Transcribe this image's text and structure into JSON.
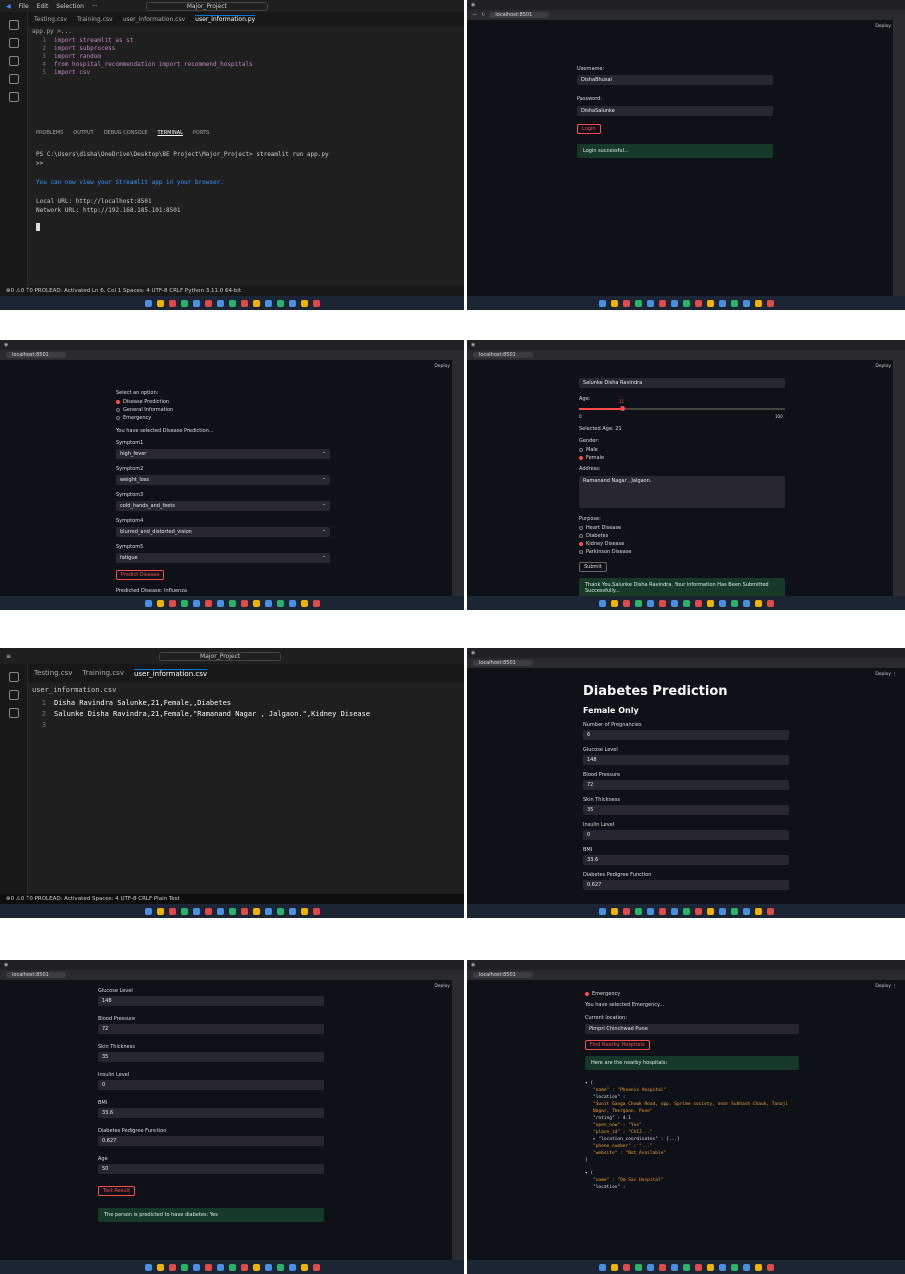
{
  "panel1": {
    "menu": [
      "File",
      "Edit",
      "Selection",
      "···"
    ],
    "search": "Major_Project",
    "tabs": [
      "Testing.csv",
      "Training.csv",
      "user_information.csv",
      "user_information.py"
    ],
    "breadcrumb": "app.py >...",
    "code": [
      [
        "1",
        "import streamlit as st"
      ],
      [
        "2",
        "import subprocess"
      ],
      [
        "3",
        "import random"
      ],
      [
        "4",
        "from hospital_recommendation import recommend_hospitals"
      ],
      [
        "5",
        "import csv"
      ]
    ],
    "term_tabs": [
      "PROBLEMS",
      "OUTPUT",
      "DEBUG CONSOLE",
      "TERMINAL",
      "PORTS"
    ],
    "term_lines": [
      "PS C:\\Users\\disha\\OneDrive\\Desktop\\BE Project\\Major_Project> streamlit run app.py",
      ">>",
      "You can now view your Streamlit app in your browser.",
      "Local URL: http://localhost:8501",
      "Network URL: http://192.168.185.101:8501"
    ],
    "status": "⊗0 ⚠0  ᛘ0  PROLEAD: Activated   Ln 6, Col 1  Spaces: 4  UTF-8  CRLF  Python  3.11.0 64-bit"
  },
  "panel2": {
    "url": "localhost:8501",
    "username_label": "Username:",
    "username": "DishaBhusal",
    "password_label": "Password:",
    "password": "DishaSalunke",
    "login": "Login",
    "msg": "Login successful..."
  },
  "panel3": {
    "url": "localhost:8501",
    "choice_label": "Select an option:",
    "options": [
      "Disease Prediction",
      "General Information",
      "Emergency"
    ],
    "selected_msg": "You have selected Disease Prediction...",
    "symptoms": [
      [
        "Symptom1",
        "high_fever"
      ],
      [
        "Symptom2",
        "weight_loss"
      ],
      [
        "Symptom3",
        "cold_hands_and_feets"
      ],
      [
        "Symptom4",
        "blurred_and_distorted_vision"
      ],
      [
        "Symptom5",
        "fatigue"
      ]
    ],
    "button": "Predict Disease",
    "result": "Predicted Disease: Influenza"
  },
  "panel4": {
    "url": "localhost:8501",
    "name": "Salunke Disha Ravindra",
    "age_label": "Age:",
    "age": "21",
    "age_min": "0",
    "age_max": "100",
    "selected_age": "Selected Age: 21",
    "gender_label": "Gender:",
    "genders": [
      "Male",
      "Female"
    ],
    "address_label": "Address:",
    "address": "Ramanand Nagar , Jalgaon.",
    "purpose_label": "Purpose:",
    "purposes": [
      "Heart Disease",
      "Diabetes",
      "Kidney Disease",
      "Parkinson Disease"
    ],
    "submit": "Submit",
    "msg": "Thank You,Salunke Disha Ravindra. Your information Has Been Submitted Successfully..."
  },
  "panel5": {
    "search": "Major_Project",
    "tabs": [
      "Testing.csv",
      "Training.csv",
      "user_information.csv"
    ],
    "file": "user_information.csv",
    "lines": [
      [
        "1",
        "Disha Ravindra Salunke,21,Female,,Diabetes"
      ],
      [
        "2",
        "Salunke Disha Ravindra,21,Female,\"Ramanand Nagar , Jalgaon.\",Kidney Disease"
      ],
      [
        "3",
        ""
      ]
    ],
    "status": "⊗0 ⚠0  ᛘ0  PROLEAD: Activated     Spaces: 4  UTF-8  CRLF  Plain Text"
  },
  "panel6": {
    "url": "localhost:8501",
    "title": "Diabetes Prediction",
    "subtitle": "Female Only",
    "fields": [
      [
        "Number of Pregnancies",
        "6"
      ],
      [
        "Glucose Level",
        "148"
      ],
      [
        "Blood Pressure",
        "72"
      ],
      [
        "Skin Thickness",
        "35"
      ],
      [
        "Insulin Level",
        "0"
      ],
      [
        "BMI",
        "33.6"
      ],
      [
        "Diabetes Pedigree Function",
        "0.627"
      ]
    ]
  },
  "panel7": {
    "url": "localhost:8501",
    "fields": [
      [
        "Glucose Level",
        "148"
      ],
      [
        "Blood Pressure",
        "72"
      ],
      [
        "Skin Thickness",
        "35"
      ],
      [
        "Insulin Level",
        "0"
      ],
      [
        "BMI",
        "33.6"
      ],
      [
        "Diabetes Pedigree Function",
        "0.627"
      ],
      [
        "Age",
        "50"
      ]
    ],
    "button": "Test Result",
    "msg": "The person is predicted to have diabetes: Yes"
  },
  "panel8": {
    "url": "localhost:8501",
    "option": "Emergency",
    "selected_msg": "You have selected Emergency...",
    "loc_label": "Current location:",
    "loc": "Pimpri Chinchwad Pune",
    "button": "Find Nearby Hospitals",
    "msg": "Here are the nearby hospitals:",
    "json": [
      "▾ {",
      "\"name\" : \"Phoenix Hospital\"",
      "\"location\" :",
      "\"Sunit Ganga Chowk Road, opp. Sprime society, near Subhash Chauk, Tanaji Nagar, Thergaon, Pune\"",
      "\"rating\" : 4.1",
      "\"open_now\" : \"Yes\"",
      "\"place_id\" : \"ChIJ...\"",
      "▸ \"location_coordinates\" : {...}",
      "\"phone_number\" : \"...\"",
      "\"website\" : \"Not_Available\"",
      "}",
      "▾ {",
      "\"name\" : \"Om Sai Hospital\"",
      "\"location\" :"
    ]
  },
  "common": {
    "deploy": "Deploy ⋮"
  }
}
